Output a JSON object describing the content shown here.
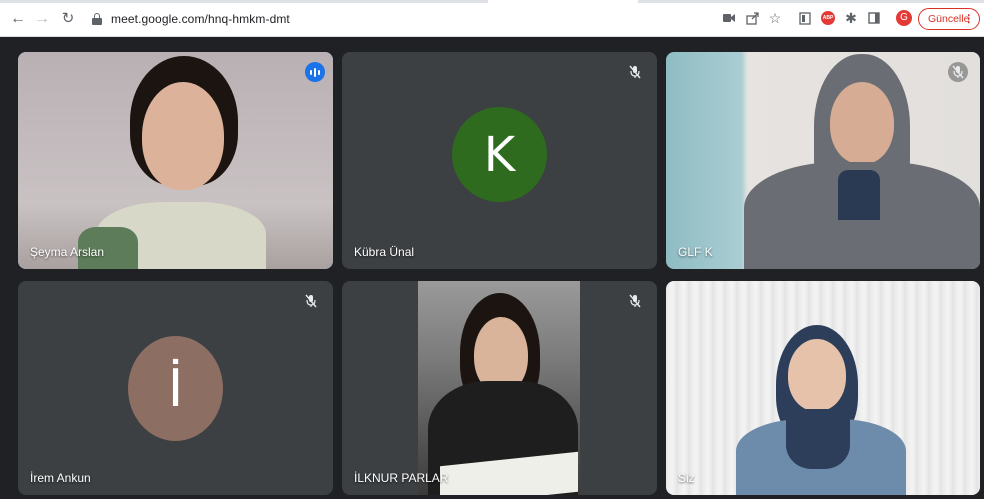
{
  "browser": {
    "url": "meet.google.com/hnq-hmkm-dmt",
    "update_label": "Güncelle",
    "profile_initial": "G",
    "abp_label": "ABP"
  },
  "meet": {
    "participants": [
      {
        "name": "Şeyma Arslan",
        "state": "speaking",
        "video": true
      },
      {
        "name": "Kübra Ünal",
        "state": "muted",
        "video": false,
        "initial": "K",
        "avatar_color": "#2e6b1f"
      },
      {
        "name": "GLF K",
        "state": "muted",
        "video": true
      },
      {
        "name": "İrem Ankun",
        "state": "muted",
        "video": false,
        "initial": "İ",
        "avatar_color": "#8d6e63"
      },
      {
        "name": "İLKNUR PARLAR",
        "state": "muted",
        "video": true
      },
      {
        "name": "Siz",
        "state": "self",
        "video": true
      }
    ]
  },
  "colors": {
    "meet_background": "#202124",
    "tile_background": "#3c4043",
    "speaking_outline": "#8ab4f8",
    "speaking_indicator": "#1a73e8",
    "update_accent": "#d93025"
  }
}
